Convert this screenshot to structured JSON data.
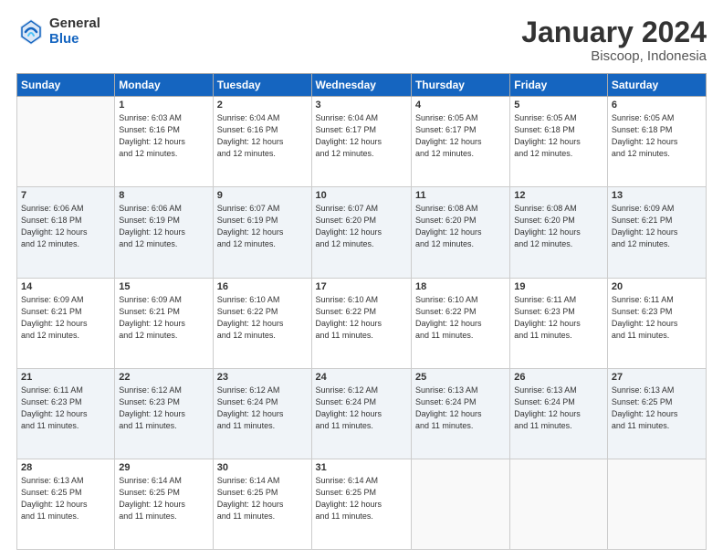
{
  "header": {
    "logo_general": "General",
    "logo_blue": "Blue",
    "month_title": "January 2024",
    "location": "Biscoop, Indonesia"
  },
  "days_of_week": [
    "Sunday",
    "Monday",
    "Tuesday",
    "Wednesday",
    "Thursday",
    "Friday",
    "Saturday"
  ],
  "weeks": [
    [
      {
        "day": "",
        "info": ""
      },
      {
        "day": "1",
        "info": "Sunrise: 6:03 AM\nSunset: 6:16 PM\nDaylight: 12 hours\nand 12 minutes."
      },
      {
        "day": "2",
        "info": "Sunrise: 6:04 AM\nSunset: 6:16 PM\nDaylight: 12 hours\nand 12 minutes."
      },
      {
        "day": "3",
        "info": "Sunrise: 6:04 AM\nSunset: 6:17 PM\nDaylight: 12 hours\nand 12 minutes."
      },
      {
        "day": "4",
        "info": "Sunrise: 6:05 AM\nSunset: 6:17 PM\nDaylight: 12 hours\nand 12 minutes."
      },
      {
        "day": "5",
        "info": "Sunrise: 6:05 AM\nSunset: 6:18 PM\nDaylight: 12 hours\nand 12 minutes."
      },
      {
        "day": "6",
        "info": "Sunrise: 6:05 AM\nSunset: 6:18 PM\nDaylight: 12 hours\nand 12 minutes."
      }
    ],
    [
      {
        "day": "7",
        "info": "Sunrise: 6:06 AM\nSunset: 6:18 PM\nDaylight: 12 hours\nand 12 minutes."
      },
      {
        "day": "8",
        "info": "Sunrise: 6:06 AM\nSunset: 6:19 PM\nDaylight: 12 hours\nand 12 minutes."
      },
      {
        "day": "9",
        "info": "Sunrise: 6:07 AM\nSunset: 6:19 PM\nDaylight: 12 hours\nand 12 minutes."
      },
      {
        "day": "10",
        "info": "Sunrise: 6:07 AM\nSunset: 6:20 PM\nDaylight: 12 hours\nand 12 minutes."
      },
      {
        "day": "11",
        "info": "Sunrise: 6:08 AM\nSunset: 6:20 PM\nDaylight: 12 hours\nand 12 minutes."
      },
      {
        "day": "12",
        "info": "Sunrise: 6:08 AM\nSunset: 6:20 PM\nDaylight: 12 hours\nand 12 minutes."
      },
      {
        "day": "13",
        "info": "Sunrise: 6:09 AM\nSunset: 6:21 PM\nDaylight: 12 hours\nand 12 minutes."
      }
    ],
    [
      {
        "day": "14",
        "info": "Sunrise: 6:09 AM\nSunset: 6:21 PM\nDaylight: 12 hours\nand 12 minutes."
      },
      {
        "day": "15",
        "info": "Sunrise: 6:09 AM\nSunset: 6:21 PM\nDaylight: 12 hours\nand 12 minutes."
      },
      {
        "day": "16",
        "info": "Sunrise: 6:10 AM\nSunset: 6:22 PM\nDaylight: 12 hours\nand 12 minutes."
      },
      {
        "day": "17",
        "info": "Sunrise: 6:10 AM\nSunset: 6:22 PM\nDaylight: 12 hours\nand 11 minutes."
      },
      {
        "day": "18",
        "info": "Sunrise: 6:10 AM\nSunset: 6:22 PM\nDaylight: 12 hours\nand 11 minutes."
      },
      {
        "day": "19",
        "info": "Sunrise: 6:11 AM\nSunset: 6:23 PM\nDaylight: 12 hours\nand 11 minutes."
      },
      {
        "day": "20",
        "info": "Sunrise: 6:11 AM\nSunset: 6:23 PM\nDaylight: 12 hours\nand 11 minutes."
      }
    ],
    [
      {
        "day": "21",
        "info": "Sunrise: 6:11 AM\nSunset: 6:23 PM\nDaylight: 12 hours\nand 11 minutes."
      },
      {
        "day": "22",
        "info": "Sunrise: 6:12 AM\nSunset: 6:23 PM\nDaylight: 12 hours\nand 11 minutes."
      },
      {
        "day": "23",
        "info": "Sunrise: 6:12 AM\nSunset: 6:24 PM\nDaylight: 12 hours\nand 11 minutes."
      },
      {
        "day": "24",
        "info": "Sunrise: 6:12 AM\nSunset: 6:24 PM\nDaylight: 12 hours\nand 11 minutes."
      },
      {
        "day": "25",
        "info": "Sunrise: 6:13 AM\nSunset: 6:24 PM\nDaylight: 12 hours\nand 11 minutes."
      },
      {
        "day": "26",
        "info": "Sunrise: 6:13 AM\nSunset: 6:24 PM\nDaylight: 12 hours\nand 11 minutes."
      },
      {
        "day": "27",
        "info": "Sunrise: 6:13 AM\nSunset: 6:25 PM\nDaylight: 12 hours\nand 11 minutes."
      }
    ],
    [
      {
        "day": "28",
        "info": "Sunrise: 6:13 AM\nSunset: 6:25 PM\nDaylight: 12 hours\nand 11 minutes."
      },
      {
        "day": "29",
        "info": "Sunrise: 6:14 AM\nSunset: 6:25 PM\nDaylight: 12 hours\nand 11 minutes."
      },
      {
        "day": "30",
        "info": "Sunrise: 6:14 AM\nSunset: 6:25 PM\nDaylight: 12 hours\nand 11 minutes."
      },
      {
        "day": "31",
        "info": "Sunrise: 6:14 AM\nSunset: 6:25 PM\nDaylight: 12 hours\nand 11 minutes."
      },
      {
        "day": "",
        "info": ""
      },
      {
        "day": "",
        "info": ""
      },
      {
        "day": "",
        "info": ""
      }
    ]
  ]
}
